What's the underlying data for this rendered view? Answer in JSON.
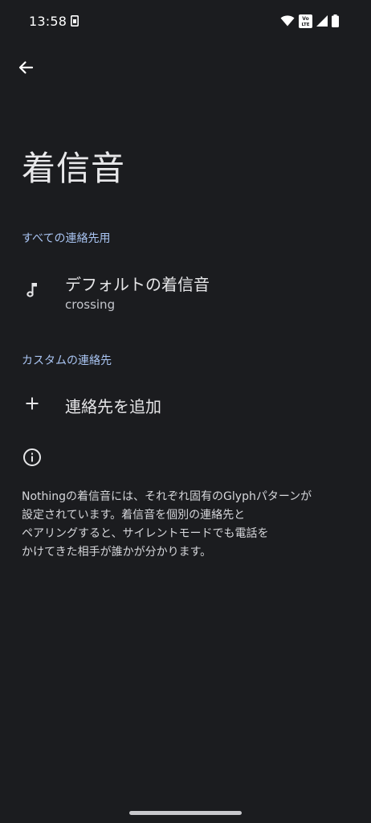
{
  "status_bar": {
    "time": "13:58",
    "volte_label": "Vo LTE",
    "icons": [
      "sim-icon",
      "wifi-icon",
      "volte-icon",
      "signal-icon",
      "battery-icon"
    ]
  },
  "header": {
    "back_icon": "arrow-left-icon",
    "title": "着信音"
  },
  "sections": {
    "all_contacts": {
      "header": "すべての連絡先用",
      "item": {
        "icon": "music-note-icon",
        "title": "デフォルトの着信音",
        "subtitle": "crossing"
      }
    },
    "custom_contacts": {
      "header": "カスタムの連絡先",
      "item": {
        "icon": "plus-icon",
        "title": "連絡先を追加"
      }
    }
  },
  "info": {
    "icon": "info-icon",
    "lines": [
      "Nothingの着信音には、それぞれ固有のGlyphパターンが",
      "設定されています。着信音を個別の連絡先と",
      "ペアリングすると、サイレントモードでも電話を",
      "かけてきた相手が誰かが分かります。"
    ]
  },
  "colors": {
    "background": "#1b1c1f",
    "accent": "#a9c4f2",
    "text_primary": "#e6e6e8",
    "text_secondary": "#c4c6cc"
  }
}
